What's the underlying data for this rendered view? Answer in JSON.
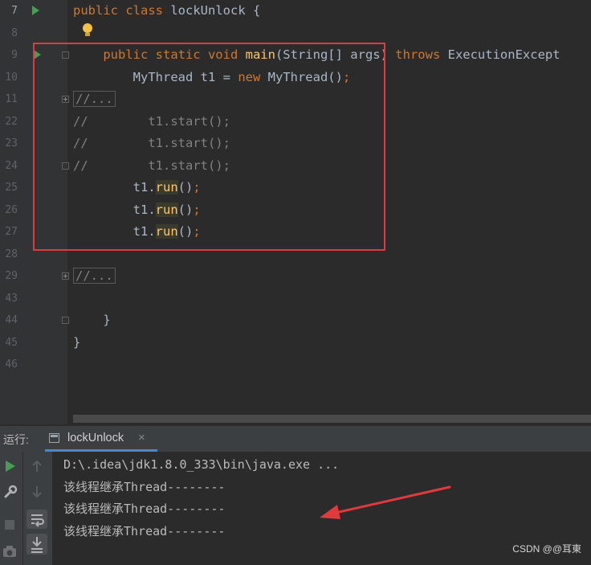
{
  "editor": {
    "lines": [
      {
        "number": "7",
        "segments": [
          {
            "t": "public class ",
            "c": "kw"
          },
          {
            "t": "lockUnlock {",
            "c": "pl"
          }
        ]
      },
      {
        "number": "8",
        "segments": []
      },
      {
        "number": "9",
        "segments": [
          {
            "t": "    public static void ",
            "c": "kw"
          },
          {
            "t": "main",
            "c": "fn"
          },
          {
            "t": "(String[] args) ",
            "c": "pl"
          },
          {
            "t": "throws ",
            "c": "kw"
          },
          {
            "t": "ExecutionExcept",
            "c": "pl"
          }
        ]
      },
      {
        "number": "10",
        "segments": [
          {
            "t": "        MyThread t1 = ",
            "c": "pl"
          },
          {
            "t": "new ",
            "c": "kw"
          },
          {
            "t": "MyThread()",
            "c": "pl"
          },
          {
            "t": ";",
            "c": "kw"
          }
        ]
      },
      {
        "number": "11",
        "segments": [
          {
            "t": "//...",
            "c": "cm",
            "box": true
          }
        ]
      },
      {
        "number": "22",
        "segments": [
          {
            "t": "//        t1.start();",
            "c": "cm"
          }
        ]
      },
      {
        "number": "23",
        "segments": [
          {
            "t": "//        t1.start();",
            "c": "cm"
          }
        ]
      },
      {
        "number": "24",
        "segments": [
          {
            "t": "//        t1.start();",
            "c": "cm"
          }
        ]
      },
      {
        "number": "25",
        "segments": [
          {
            "t": "        t1.",
            "c": "pl"
          },
          {
            "t": "run",
            "c": "hl"
          },
          {
            "t": "()",
            "c": "pl"
          },
          {
            "t": ";",
            "c": "kw"
          }
        ]
      },
      {
        "number": "26",
        "segments": [
          {
            "t": "        t1.",
            "c": "pl"
          },
          {
            "t": "run",
            "c": "hl"
          },
          {
            "t": "()",
            "c": "pl"
          },
          {
            "t": ";",
            "c": "kw"
          }
        ]
      },
      {
        "number": "27",
        "segments": [
          {
            "t": "        t1.",
            "c": "pl"
          },
          {
            "t": "run",
            "c": "hl"
          },
          {
            "t": "()",
            "c": "pl"
          },
          {
            "t": ";",
            "c": "kw"
          }
        ]
      },
      {
        "number": "28",
        "segments": []
      },
      {
        "number": "29",
        "segments": [
          {
            "t": "//...",
            "c": "cm",
            "box": true
          }
        ]
      },
      {
        "number": "43",
        "segments": []
      },
      {
        "number": "44",
        "segments": [
          {
            "t": "    }",
            "c": "pl"
          }
        ]
      },
      {
        "number": "45",
        "segments": [
          {
            "t": "}",
            "c": "pl"
          }
        ]
      },
      {
        "number": "46",
        "segments": []
      }
    ]
  },
  "run_panel": {
    "label": "运行:",
    "tab_label": "lockUnlock",
    "tab_close": "×"
  },
  "console": {
    "command": "D:\\.idea\\jdk1.8.0_333\\bin\\java.exe ...",
    "output": [
      "该线程继承Thread--------",
      "该线程继承Thread--------",
      "该线程继承Thread--------"
    ]
  },
  "watermark": "CSDN @@耳東",
  "colors": {
    "keyword": "#cc7832",
    "function": "#ffc66d",
    "comment": "#808080",
    "plain": "#a9b7c6",
    "highlight_box": "#e0393e",
    "arrow": "#e0393e",
    "run_icon": "#499c54"
  }
}
